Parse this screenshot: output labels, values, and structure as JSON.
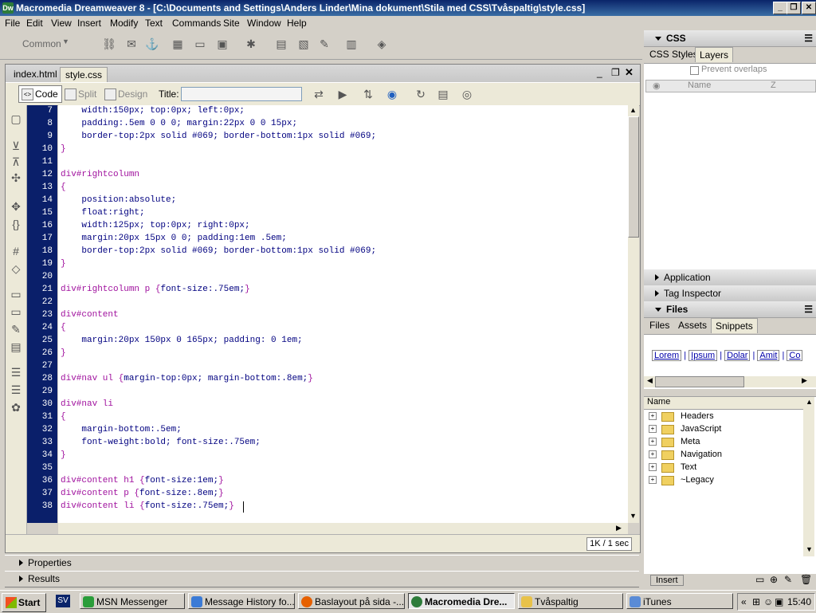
{
  "window": {
    "title": "Macromedia Dreamweaver 8 - [C:\\Documents and Settings\\Anders Linder\\Mina dokument\\Stila med CSS\\Tvåspaltig\\style.css]",
    "minimize": "_",
    "maximize": "❐",
    "close": "✕"
  },
  "menu": [
    "File",
    "Edit",
    "View",
    "Insert",
    "Modify",
    "Text",
    "Commands",
    "Site",
    "Window",
    "Help"
  ],
  "insert_toolbar": {
    "category": "Common"
  },
  "doc": {
    "tabs": [
      "index.html",
      "style.css"
    ],
    "active_tab": "style.css",
    "views": {
      "code": "Code",
      "split": "Split",
      "design": "Design"
    },
    "title_label": "Title:",
    "title_value": "",
    "status": "1K / 1 sec"
  },
  "code_lines": [
    {
      "n": "7",
      "segs": [
        [
          "p",
          "    width:150px; top:0px; left:0px;"
        ]
      ]
    },
    {
      "n": "8",
      "segs": [
        [
          "p",
          "    padding:.5em 0 0 0; margin:22px 0 0 15px;"
        ]
      ]
    },
    {
      "n": "9",
      "segs": [
        [
          "p",
          "    border-top:2px solid #069; border-bottom:1px solid #069;"
        ]
      ]
    },
    {
      "n": "10",
      "segs": [
        [
          "b",
          "}"
        ]
      ]
    },
    {
      "n": "11",
      "segs": []
    },
    {
      "n": "12",
      "segs": [
        [
          "s",
          "div#rightcolumn"
        ]
      ]
    },
    {
      "n": "13",
      "segs": [
        [
          "b",
          "{"
        ]
      ]
    },
    {
      "n": "14",
      "segs": [
        [
          "p",
          "    position:absolute;"
        ]
      ]
    },
    {
      "n": "15",
      "segs": [
        [
          "p",
          "    float:right;"
        ]
      ]
    },
    {
      "n": "16",
      "segs": [
        [
          "p",
          "    width:125px; top:0px; right:0px;"
        ]
      ]
    },
    {
      "n": "17",
      "segs": [
        [
          "p",
          "    margin:20px 15px 0 0; padding:1em .5em;"
        ]
      ]
    },
    {
      "n": "18",
      "segs": [
        [
          "p",
          "    border-top:2px solid #069; border-bottom:1px solid #069;"
        ]
      ]
    },
    {
      "n": "19",
      "segs": [
        [
          "b",
          "}"
        ]
      ]
    },
    {
      "n": "20",
      "segs": []
    },
    {
      "n": "21",
      "segs": [
        [
          "s",
          "div#rightcolumn p "
        ],
        [
          "b",
          "{"
        ],
        [
          "p",
          "font-size:.75em;"
        ],
        [
          "b",
          "}"
        ]
      ]
    },
    {
      "n": "22",
      "segs": []
    },
    {
      "n": "23",
      "segs": [
        [
          "s",
          "div#content"
        ]
      ]
    },
    {
      "n": "24",
      "segs": [
        [
          "b",
          "{"
        ]
      ]
    },
    {
      "n": "25",
      "segs": [
        [
          "p",
          "    margin:20px 150px 0 165px; padding: 0 1em;"
        ]
      ]
    },
    {
      "n": "26",
      "segs": [
        [
          "b",
          "}"
        ]
      ]
    },
    {
      "n": "27",
      "segs": []
    },
    {
      "n": "28",
      "segs": [
        [
          "s",
          "div#nav ul "
        ],
        [
          "b",
          "{"
        ],
        [
          "p",
          "margin-top:0px; margin-bottom:.8em;"
        ],
        [
          "b",
          "}"
        ]
      ]
    },
    {
      "n": "29",
      "segs": []
    },
    {
      "n": "30",
      "segs": [
        [
          "s",
          "div#nav li"
        ]
      ]
    },
    {
      "n": "31",
      "segs": [
        [
          "b",
          "{"
        ]
      ]
    },
    {
      "n": "32",
      "segs": [
        [
          "p",
          "    margin-bottom:.5em;"
        ]
      ]
    },
    {
      "n": "33",
      "segs": [
        [
          "p",
          "    font-weight:bold; font-size:.75em;"
        ]
      ]
    },
    {
      "n": "34",
      "segs": [
        [
          "b",
          "}"
        ]
      ]
    },
    {
      "n": "35",
      "segs": []
    },
    {
      "n": "36",
      "segs": [
        [
          "s",
          "div#content h1 "
        ],
        [
          "b",
          "{"
        ],
        [
          "p",
          "font-size:1em;"
        ],
        [
          "b",
          "}"
        ]
      ]
    },
    {
      "n": "37",
      "segs": [
        [
          "s",
          "div#content p "
        ],
        [
          "b",
          "{"
        ],
        [
          "p",
          "font-size:.8em;"
        ],
        [
          "b",
          "}"
        ]
      ]
    },
    {
      "n": "38",
      "segs": [
        [
          "s",
          "div#content li "
        ],
        [
          "b",
          "{"
        ],
        [
          "p",
          "font-size:.75em;"
        ],
        [
          "b",
          "}"
        ]
      ]
    }
  ],
  "bottom_panels": {
    "properties": "Properties",
    "results": "Results"
  },
  "right_panel": {
    "css_title": "CSS",
    "css_tabs": [
      "CSS Styles",
      "Layers"
    ],
    "css_active": "Layers",
    "prevent_overlaps": "Prevent overlaps",
    "layers_cols": [
      "Name",
      "Z"
    ],
    "application": "Application",
    "tag_inspector": "Tag Inspector",
    "files_title": "Files",
    "files_tabs": [
      "Files",
      "Assets",
      "Snippets"
    ],
    "files_active": "Snippets",
    "snippet_preview": [
      "Lorem",
      "Ipsum",
      "Dolar",
      "Amit",
      "Co"
    ],
    "tree_header": "Name",
    "folders": [
      "Headers",
      "JavaScript",
      "Meta",
      "Navigation",
      "Text",
      "~Legacy"
    ],
    "insert_btn": "Insert"
  },
  "taskbar": {
    "start": "Start",
    "lang": "SV",
    "tasks": [
      "MSN Messenger",
      "Message History fo...",
      "Baslayout på sida -...",
      "Macromedia Dre...",
      "Tvåspaltig",
      "iTunes"
    ],
    "active_task": "Macromedia Dre...",
    "clock": "15:40"
  }
}
